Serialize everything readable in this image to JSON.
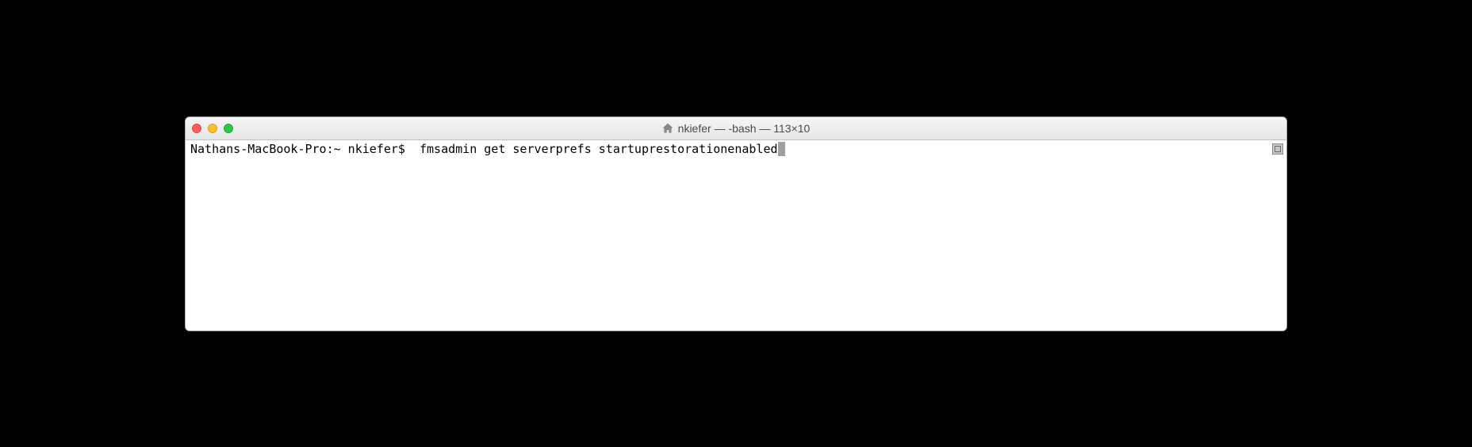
{
  "window": {
    "title": "nkiefer — -bash — 113×10"
  },
  "terminal": {
    "prompt": "Nathans-MacBook-Pro:~ nkiefer$  ",
    "command": "fmsadmin get serverprefs startuprestorationenabled"
  }
}
